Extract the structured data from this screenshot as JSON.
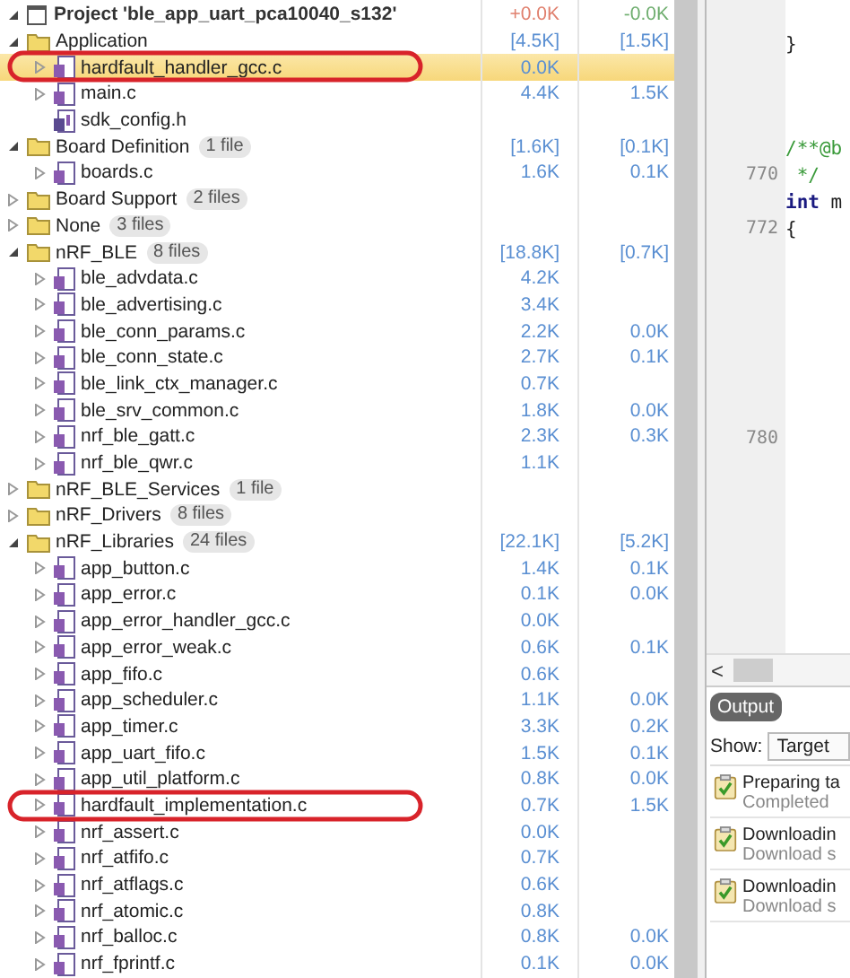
{
  "project": {
    "name": "Project 'ble_app_uart_pca10040_s132'",
    "size": "+0.0K",
    "size2": "-0.0K",
    "expanded": true,
    "children": [
      {
        "kind": "folder",
        "name": "Application",
        "expanded": true,
        "selected": false,
        "circled": false,
        "size": "[4.5K]",
        "size2": "[1.5K]",
        "children": [
          {
            "kind": "file",
            "name": "hardfault_handler_gcc.c",
            "expanded": false,
            "selected": true,
            "circled": true,
            "size": "0.0K"
          },
          {
            "kind": "file",
            "name": "main.c",
            "expanded": false,
            "selected": false,
            "circled": false,
            "size": "4.4K",
            "size2": "1.5K"
          },
          {
            "kind": "header",
            "name": "sdk_config.h",
            "selected": false,
            "circled": false
          }
        ]
      },
      {
        "kind": "folder",
        "name": "Board Definition",
        "badge": "1 file",
        "expanded": true,
        "selected": false,
        "circled": false,
        "size": "[1.6K]",
        "size2": "[0.1K]",
        "children": [
          {
            "kind": "file",
            "name": "boards.c",
            "expanded": false,
            "selected": false,
            "circled": false,
            "size": "1.6K",
            "size2": "0.1K"
          }
        ]
      },
      {
        "kind": "folder",
        "name": "Board Support",
        "badge": "2 files",
        "expanded": false,
        "selected": false,
        "circled": false
      },
      {
        "kind": "folder",
        "name": "None",
        "badge": "3 files",
        "expanded": false,
        "selected": false,
        "circled": false
      },
      {
        "kind": "folder",
        "name": "nRF_BLE",
        "badge": "8 files",
        "expanded": true,
        "selected": false,
        "circled": false,
        "size": "[18.8K]",
        "size2": "[0.7K]",
        "children": [
          {
            "kind": "file",
            "name": "ble_advdata.c",
            "expanded": false,
            "selected": false,
            "circled": false,
            "size": "4.2K"
          },
          {
            "kind": "file",
            "name": "ble_advertising.c",
            "expanded": false,
            "selected": false,
            "circled": false,
            "size": "3.4K"
          },
          {
            "kind": "file",
            "name": "ble_conn_params.c",
            "expanded": false,
            "selected": false,
            "circled": false,
            "size": "2.2K",
            "size2": "0.0K"
          },
          {
            "kind": "file",
            "name": "ble_conn_state.c",
            "expanded": false,
            "selected": false,
            "circled": false,
            "size": "2.7K",
            "size2": "0.1K"
          },
          {
            "kind": "file",
            "name": "ble_link_ctx_manager.c",
            "expanded": false,
            "selected": false,
            "circled": false,
            "size": "0.7K"
          },
          {
            "kind": "file",
            "name": "ble_srv_common.c",
            "expanded": false,
            "selected": false,
            "circled": false,
            "size": "1.8K",
            "size2": "0.0K"
          },
          {
            "kind": "file",
            "name": "nrf_ble_gatt.c",
            "expanded": false,
            "selected": false,
            "circled": false,
            "size": "2.3K",
            "size2": "0.3K"
          },
          {
            "kind": "file",
            "name": "nrf_ble_qwr.c",
            "expanded": false,
            "selected": false,
            "circled": false,
            "size": "1.1K"
          }
        ]
      },
      {
        "kind": "folder",
        "name": "nRF_BLE_Services",
        "badge": "1 file",
        "expanded": false,
        "selected": false,
        "circled": false
      },
      {
        "kind": "folder",
        "name": "nRF_Drivers",
        "badge": "8 files",
        "expanded": false,
        "selected": false,
        "circled": false
      },
      {
        "kind": "folder",
        "name": "nRF_Libraries",
        "badge": "24 files",
        "expanded": true,
        "selected": false,
        "circled": false,
        "size": "[22.1K]",
        "size2": "[5.2K]",
        "children": [
          {
            "kind": "file",
            "name": "app_button.c",
            "expanded": false,
            "selected": false,
            "circled": false,
            "size": "1.4K",
            "size2": "0.1K"
          },
          {
            "kind": "file",
            "name": "app_error.c",
            "expanded": false,
            "selected": false,
            "circled": false,
            "size": "0.1K",
            "size2": "0.0K"
          },
          {
            "kind": "file",
            "name": "app_error_handler_gcc.c",
            "expanded": false,
            "selected": false,
            "circled": false,
            "size": "0.0K"
          },
          {
            "kind": "file",
            "name": "app_error_weak.c",
            "expanded": false,
            "selected": false,
            "circled": false,
            "size": "0.6K",
            "size2": "0.1K"
          },
          {
            "kind": "file",
            "name": "app_fifo.c",
            "expanded": false,
            "selected": false,
            "circled": false,
            "size": "0.6K"
          },
          {
            "kind": "file",
            "name": "app_scheduler.c",
            "expanded": false,
            "selected": false,
            "circled": false,
            "size": "1.1K",
            "size2": "0.0K"
          },
          {
            "kind": "file",
            "name": "app_timer.c",
            "expanded": false,
            "selected": false,
            "circled": false,
            "size": "3.3K",
            "size2": "0.2K"
          },
          {
            "kind": "file",
            "name": "app_uart_fifo.c",
            "expanded": false,
            "selected": false,
            "circled": false,
            "size": "1.5K",
            "size2": "0.1K"
          },
          {
            "kind": "file",
            "name": "app_util_platform.c",
            "expanded": false,
            "selected": false,
            "circled": false,
            "size": "0.8K",
            "size2": "0.0K"
          },
          {
            "kind": "file",
            "name": "hardfault_implementation.c",
            "expanded": false,
            "selected": false,
            "circled": true,
            "size": "0.7K",
            "size2": "1.5K"
          },
          {
            "kind": "file",
            "name": "nrf_assert.c",
            "expanded": false,
            "selected": false,
            "circled": false,
            "size": "0.0K"
          },
          {
            "kind": "file",
            "name": "nrf_atfifo.c",
            "expanded": false,
            "selected": false,
            "circled": false,
            "size": "0.7K"
          },
          {
            "kind": "file",
            "name": "nrf_atflags.c",
            "expanded": false,
            "selected": false,
            "circled": false,
            "size": "0.6K"
          },
          {
            "kind": "file",
            "name": "nrf_atomic.c",
            "expanded": false,
            "selected": false,
            "circled": false,
            "size": "0.8K"
          },
          {
            "kind": "file",
            "name": "nrf_balloc.c",
            "expanded": false,
            "selected": false,
            "circled": false,
            "size": "0.8K",
            "size2": "0.0K"
          },
          {
            "kind": "file",
            "name": "nrf_fprintf.c",
            "expanded": false,
            "selected": false,
            "circled": false,
            "size": "0.1K",
            "size2": "0.0K"
          }
        ]
      }
    ]
  },
  "editor": {
    "lines": [
      {
        "kind": "blank"
      },
      {
        "kind": "plain",
        "code": "}"
      },
      {
        "kind": "blank"
      },
      {
        "kind": "blank"
      },
      {
        "kind": "blank"
      },
      {
        "kind": "comment",
        "code": "/**@b"
      },
      {
        "kind": "comment",
        "number": "770",
        "code": " */"
      },
      {
        "kind": "keyword",
        "keyword": "int",
        "code": " m"
      },
      {
        "kind": "plain",
        "number": "772",
        "code": "{"
      },
      {
        "kind": "blank"
      },
      {
        "kind": "blank"
      },
      {
        "kind": "blank"
      },
      {
        "kind": "blank"
      },
      {
        "kind": "blank"
      },
      {
        "kind": "blank"
      },
      {
        "kind": "blank"
      },
      {
        "kind": "plain",
        "number": "780"
      }
    ],
    "scroll_left": "<"
  },
  "output": {
    "tab": "Output",
    "show_label": "Show:",
    "show_value": "Target",
    "entries": [
      {
        "title": "Preparing ta",
        "detail": "Completed"
      },
      {
        "title": "Downloadin",
        "detail": "Download s"
      },
      {
        "title": "Downloadin",
        "detail": "Download s"
      }
    ]
  }
}
